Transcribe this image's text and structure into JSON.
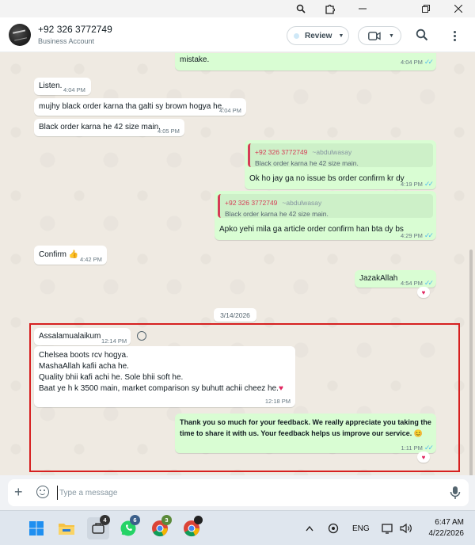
{
  "contact": {
    "name": "+92 326 3772749",
    "subtitle": "Business Account"
  },
  "header": {
    "review_label": "Review"
  },
  "messages": [
    {
      "text": "mistake.",
      "time": "4:04 PM"
    },
    {
      "text": "Listen.",
      "time": "4:04 PM"
    },
    {
      "text": "mujhy black order karna tha galti sy brown hogya he.",
      "time": "4:04 PM"
    },
    {
      "text": "Black order karna he 42 size main.",
      "time": "4:05 PM"
    },
    {
      "quote_name": "+92 326 3772749",
      "quote_alias": "~abdulwasay",
      "quote_text": "Black order karna he 42 size main.",
      "text": "Ok ho jay ga no issue bs order confirm kr dy",
      "time": "4:19 PM"
    },
    {
      "quote_name": "+92 326 3772749",
      "quote_alias": "~abdulwasay",
      "quote_text": "Black order karna he 42 size main.",
      "text": "Apko yehi mila ga article order confirm han bta dy bs",
      "time": "4:29 PM"
    },
    {
      "text": "Confirm",
      "emoji": "👍",
      "time": "4:42 PM"
    },
    {
      "text": "JazakAllah",
      "time": "4:54 PM",
      "reaction": "♥"
    },
    {
      "text": "Assalamualaikum",
      "time": "12:14 PM"
    },
    {
      "lines": [
        "Chelsea boots rcv hogya.",
        "MashaAllah kafii acha he.",
        "Quality bhii kafi achi he. Sole bhii soft he.",
        "Baat ye h k 3500 main, market comparison sy buhutt achii cheez he."
      ],
      "emoji": "♥",
      "time": "12:18 PM"
    },
    {
      "lines": [
        "Thank you so much for your feedback. We really appreciate you taking the",
        "time to share it with us. Your feedback helps us improve our service."
      ],
      "emoji": "😊",
      "time": "1:11 PM",
      "reaction": "♥"
    }
  ],
  "date_separator": "3/14/2026",
  "composer": {
    "placeholder": "Type a message"
  },
  "taskbar": {
    "badges": {
      "app1": "4",
      "whatsapp": "6",
      "chrome1": "3"
    },
    "language": "ENG",
    "time": "6:47 AM",
    "date": "4/22/2026"
  },
  "colors": {
    "outgoing_bubble": "#d9fdd3",
    "highlight_border": "#d62020",
    "quote_accent": "#d63d57",
    "read_ticks": "#53bdeb"
  }
}
